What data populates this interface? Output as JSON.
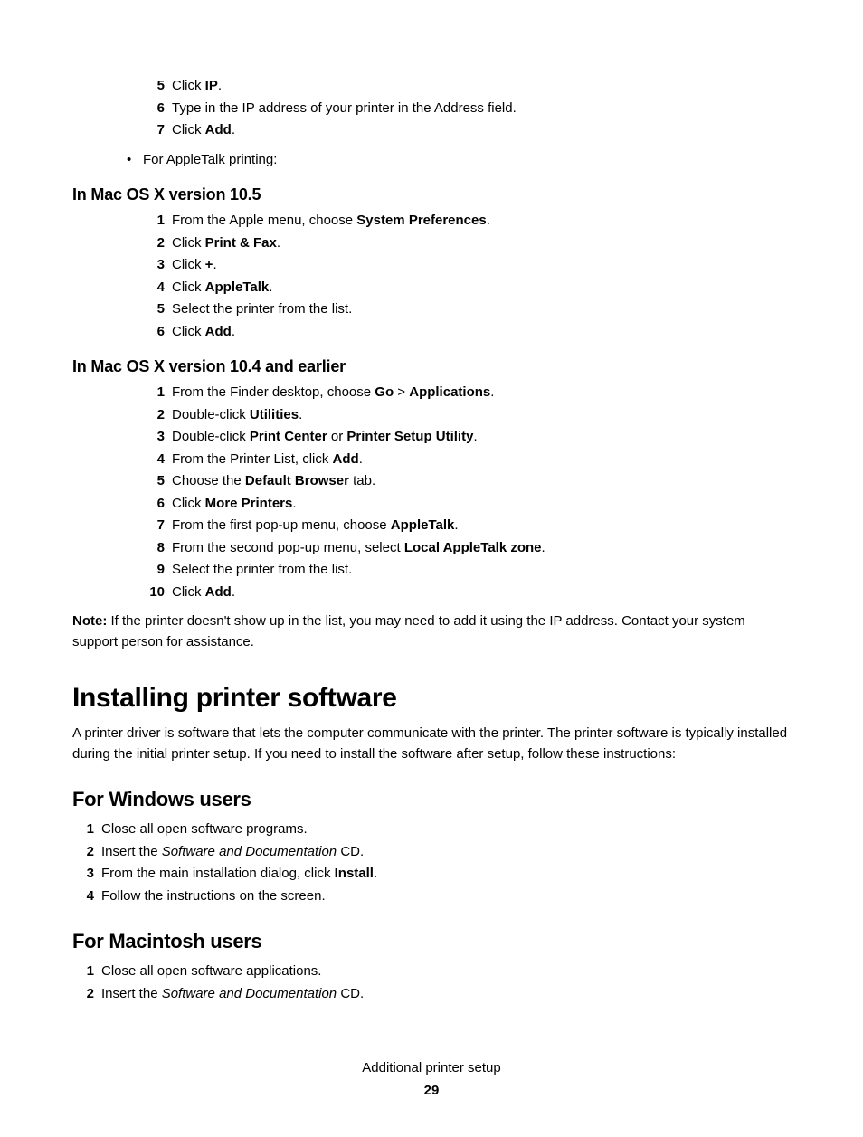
{
  "top_steps": [
    {
      "num": "5",
      "parts": [
        {
          "t": "Click "
        },
        {
          "t": "IP",
          "b": true
        },
        {
          "t": "."
        }
      ]
    },
    {
      "num": "6",
      "parts": [
        {
          "t": "Type in the IP address of your printer in the Address field."
        }
      ]
    },
    {
      "num": "7",
      "parts": [
        {
          "t": "Click "
        },
        {
          "t": "Add",
          "b": true
        },
        {
          "t": "."
        }
      ]
    }
  ],
  "bullet_line": "For AppleTalk printing:",
  "heading_105": "In Mac OS X version 10.5",
  "steps_105": [
    {
      "num": "1",
      "parts": [
        {
          "t": "From the Apple menu, choose "
        },
        {
          "t": "System Preferences",
          "b": true
        },
        {
          "t": "."
        }
      ]
    },
    {
      "num": "2",
      "parts": [
        {
          "t": "Click "
        },
        {
          "t": "Print & Fax",
          "b": true
        },
        {
          "t": "."
        }
      ]
    },
    {
      "num": "3",
      "parts": [
        {
          "t": "Click "
        },
        {
          "t": "+",
          "b": true
        },
        {
          "t": "."
        }
      ]
    },
    {
      "num": "4",
      "parts": [
        {
          "t": "Click "
        },
        {
          "t": "AppleTalk",
          "b": true
        },
        {
          "t": "."
        }
      ]
    },
    {
      "num": "5",
      "parts": [
        {
          "t": "Select the printer from the list."
        }
      ]
    },
    {
      "num": "6",
      "parts": [
        {
          "t": "Click "
        },
        {
          "t": "Add",
          "b": true
        },
        {
          "t": "."
        }
      ]
    }
  ],
  "heading_104": "In Mac OS X version 10.4 and earlier",
  "steps_104": [
    {
      "num": "1",
      "parts": [
        {
          "t": "From the Finder desktop, choose "
        },
        {
          "t": "Go",
          "b": true
        },
        {
          "t": " > "
        },
        {
          "t": "Applications",
          "b": true
        },
        {
          "t": "."
        }
      ]
    },
    {
      "num": "2",
      "parts": [
        {
          "t": "Double-click "
        },
        {
          "t": "Utilities",
          "b": true
        },
        {
          "t": "."
        }
      ]
    },
    {
      "num": "3",
      "parts": [
        {
          "t": "Double-click "
        },
        {
          "t": "Print Center",
          "b": true
        },
        {
          "t": " or "
        },
        {
          "t": "Printer Setup Utility",
          "b": true
        },
        {
          "t": "."
        }
      ]
    },
    {
      "num": "4",
      "parts": [
        {
          "t": "From the Printer List, click "
        },
        {
          "t": "Add",
          "b": true
        },
        {
          "t": "."
        }
      ]
    },
    {
      "num": "5",
      "parts": [
        {
          "t": "Choose the "
        },
        {
          "t": "Default Browser",
          "b": true
        },
        {
          "t": " tab."
        }
      ]
    },
    {
      "num": "6",
      "parts": [
        {
          "t": "Click "
        },
        {
          "t": "More Printers",
          "b": true
        },
        {
          "t": "."
        }
      ]
    },
    {
      "num": "7",
      "parts": [
        {
          "t": "From the first pop-up menu, choose "
        },
        {
          "t": "AppleTalk",
          "b": true
        },
        {
          "t": "."
        }
      ]
    },
    {
      "num": "8",
      "parts": [
        {
          "t": "From the second pop-up menu, select "
        },
        {
          "t": "Local AppleTalk zone",
          "b": true
        },
        {
          "t": "."
        }
      ]
    },
    {
      "num": "9",
      "parts": [
        {
          "t": "Select the printer from the list."
        }
      ]
    },
    {
      "num": "10",
      "parts": [
        {
          "t": "Click "
        },
        {
          "t": "Add",
          "b": true
        },
        {
          "t": "."
        }
      ]
    }
  ],
  "note_label": "Note:",
  "note_text": " If the printer doesn't show up in the list, you may need to add it using the IP address. Contact your system support person for assistance.",
  "h1": "Installing printer software",
  "intro": "A printer driver is software that lets the computer communicate with the printer. The printer software is typically installed during the initial printer setup. If you need to install the software after setup, follow these instructions:",
  "h2_win": "For Windows users",
  "steps_win": [
    {
      "num": "1",
      "parts": [
        {
          "t": "Close all open software programs."
        }
      ]
    },
    {
      "num": "2",
      "parts": [
        {
          "t": "Insert the "
        },
        {
          "t": "Software and Documentation",
          "i": true
        },
        {
          "t": " CD."
        }
      ]
    },
    {
      "num": "3",
      "parts": [
        {
          "t": "From the main installation dialog, click "
        },
        {
          "t": "Install",
          "b": true
        },
        {
          "t": "."
        }
      ]
    },
    {
      "num": "4",
      "parts": [
        {
          "t": "Follow the instructions on the screen."
        }
      ]
    }
  ],
  "h2_mac": "For Macintosh users",
  "steps_mac": [
    {
      "num": "1",
      "parts": [
        {
          "t": "Close all open software applications."
        }
      ]
    },
    {
      "num": "2",
      "parts": [
        {
          "t": "Insert the "
        },
        {
          "t": "Software and Documentation",
          "i": true
        },
        {
          "t": " CD."
        }
      ]
    }
  ],
  "footer_title": "Additional printer setup",
  "footer_page": "29"
}
